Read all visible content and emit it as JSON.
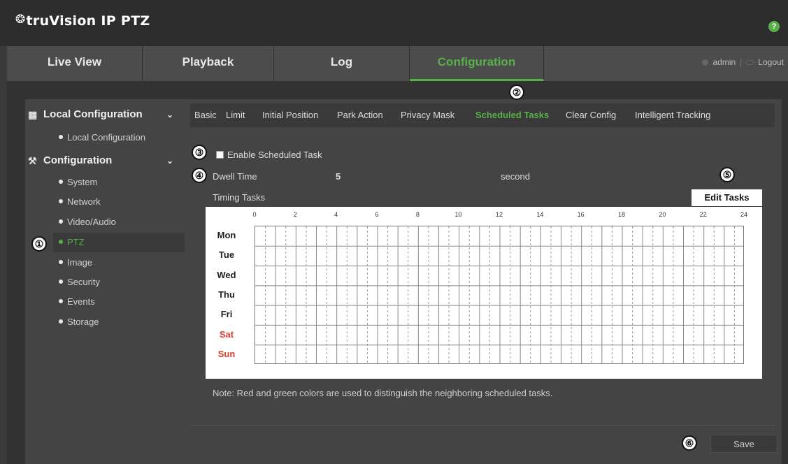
{
  "app": {
    "logo_mark": "❂",
    "logo_text": "truVision IP PTZ",
    "help_label": "?",
    "accent_color": "#58b048"
  },
  "topnav": {
    "tabs": [
      {
        "label": "Live View",
        "active": false
      },
      {
        "label": "Playback",
        "active": false
      },
      {
        "label": "Log",
        "active": false
      },
      {
        "label": "Configuration",
        "active": true
      }
    ],
    "user": "admin",
    "logout": "Logout"
  },
  "sidebar": {
    "local_configuration": {
      "label": "Local Configuration",
      "icon": "computer-settings-icon",
      "expanded": true,
      "items": [
        "Local Configuration"
      ]
    },
    "configuration": {
      "label": "Configuration",
      "icon": "wrench-icon",
      "expanded": true,
      "items": [
        "System",
        "Network",
        "Video/Audio",
        "PTZ",
        "Image",
        "Security",
        "Events",
        "Storage"
      ],
      "active_item": "PTZ"
    }
  },
  "tabs": {
    "items": [
      "Basic",
      "Limit",
      "Initial Position",
      "Park Action",
      "Privacy Mask",
      "Scheduled Tasks",
      "Clear Config",
      "Intelligent Tracking"
    ],
    "active": "Scheduled Tasks"
  },
  "form": {
    "enable_label": "Enable Scheduled Task",
    "enable_checked": false,
    "dwell_label": "Dwell Time",
    "dwell_value": "5",
    "dwell_unit": "second",
    "timing_label": "Timing Tasks",
    "edit_button": "Edit Tasks"
  },
  "schedule": {
    "hour_labels": [
      "0",
      "2",
      "4",
      "6",
      "8",
      "10",
      "12",
      "14",
      "16",
      "18",
      "20",
      "22",
      "24"
    ],
    "days": [
      {
        "name": "Mon",
        "weekend": false
      },
      {
        "name": "Tue",
        "weekend": false
      },
      {
        "name": "Wed",
        "weekend": false
      },
      {
        "name": "Thu",
        "weekend": false
      },
      {
        "name": "Fri",
        "weekend": false
      },
      {
        "name": "Sat",
        "weekend": true
      },
      {
        "name": "Sun",
        "weekend": true
      }
    ],
    "weekend_color": "#e03a2e"
  },
  "note": "Note: Red and green colors are used to distinguish the neighboring scheduled tasks.",
  "save_button": "Save",
  "callouts": [
    "①",
    "②",
    "③",
    "④",
    "⑤",
    "⑥"
  ]
}
